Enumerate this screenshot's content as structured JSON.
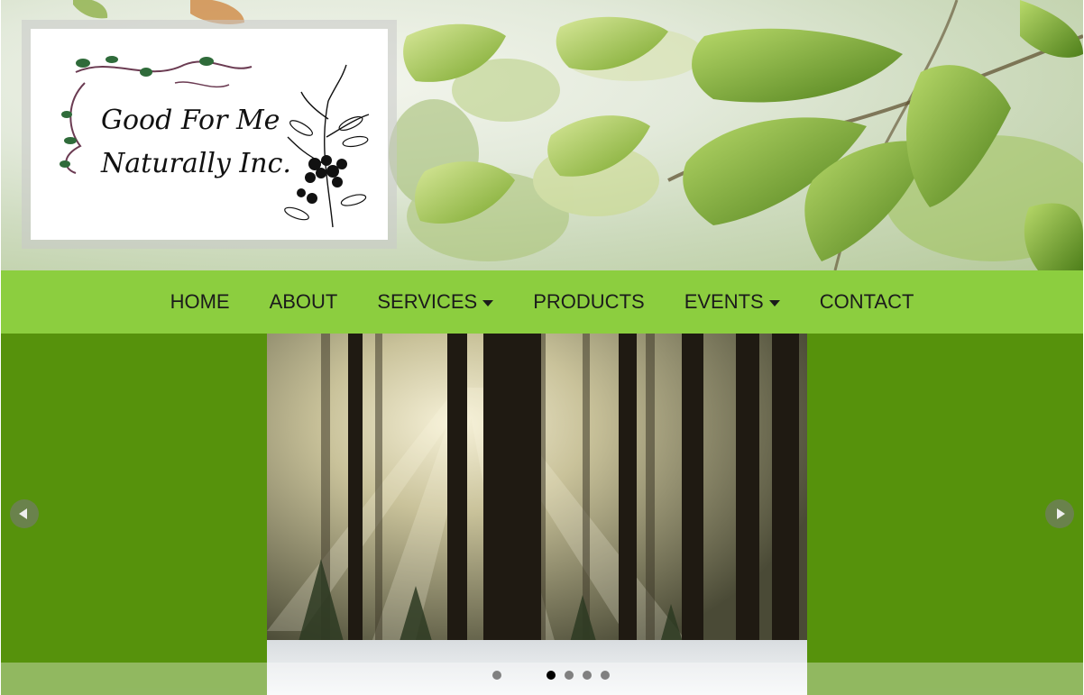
{
  "header": {
    "logo": {
      "line1": "Good For Me",
      "line2": "Naturally Inc."
    },
    "background_icon": "leaves-photo"
  },
  "nav": {
    "items": [
      {
        "label": "HOME",
        "dropdown": false
      },
      {
        "label": "ABOUT",
        "dropdown": false
      },
      {
        "label": "SERVICES",
        "dropdown": true
      },
      {
        "label": "PRODUCTS",
        "dropdown": false
      },
      {
        "label": "EVENTS",
        "dropdown": true
      },
      {
        "label": "CONTACT",
        "dropdown": false
      }
    ],
    "background_color": "#8cce3f"
  },
  "slider": {
    "background_color": "#56920c",
    "current_slide_icon": "forest-sunbeams-photo",
    "prev_icon": "chevron-left-icon",
    "next_icon": "chevron-right-icon",
    "slide_count": 6,
    "active_index": 3
  }
}
